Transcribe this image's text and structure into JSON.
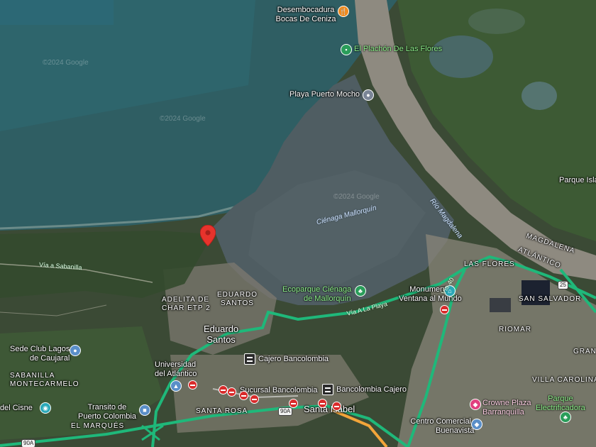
{
  "map": {
    "watermarks": [
      "©2024 Google",
      "©2024 Google",
      "©2024 Google"
    ],
    "water_bodies": {
      "cienaga": "Ciénaga Mallorquín",
      "rio": "Río Magdalena"
    },
    "places": [
      {
        "id": "desembocadura",
        "lines": [
          "Desembocadura",
          "Bocas De Ceniza"
        ],
        "icon": "fork-knife-icon",
        "color": "#ef8b1f"
      },
      {
        "id": "plachon",
        "lines": [
          "El Plachón De Las Flores"
        ],
        "icon": "shop-icon",
        "color": "#2a9d5a"
      },
      {
        "id": "playa",
        "lines": [
          "Playa Puerto Mocho"
        ],
        "icon": "beach-icon",
        "color": "#7a8596"
      },
      {
        "id": "ecoparque",
        "lines": [
          "Ecoparque Ciénaga",
          "de Mallorquín"
        ],
        "icon": "tree-icon",
        "color": "#2a9d5a"
      },
      {
        "id": "monumento",
        "lines": [
          "Monumento",
          "Ventana al Mundo"
        ],
        "icon": "landmark-icon",
        "color": "#2aa8b8"
      },
      {
        "id": "sede_club",
        "lines": [
          "Sede Club Lagos",
          "de Caujaral"
        ],
        "icon": "club-icon",
        "color": "#5a8fc8"
      },
      {
        "id": "universidad",
        "lines": [
          "Universidad",
          "del Atlántico"
        ],
        "icon": "school-icon",
        "color": "#5a8fc8"
      },
      {
        "id": "transito",
        "lines": [
          "Transito de",
          "Puerto Colombia"
        ],
        "icon": "building-icon",
        "color": "#5a8fc8"
      },
      {
        "id": "cajero1",
        "lines": [
          "Cajero Bancolombia"
        ],
        "icon": "bank-icon"
      },
      {
        "id": "sucursal",
        "lines": [
          "Sucursal Bancolombia"
        ],
        "icon": "bank-icon"
      },
      {
        "id": "bancolombia_cajero",
        "lines": [
          "Bancolombia Cajero"
        ],
        "icon": "bank-icon"
      },
      {
        "id": "crowne",
        "lines": [
          "Crowne Plaza",
          "Barranquilla"
        ],
        "icon": "shopping-bag-icon",
        "color": "#e0407f"
      },
      {
        "id": "centro_comercial",
        "lines": [
          "Centro Comercial",
          "Buenavista"
        ],
        "icon": "shopping-bag-icon",
        "color": "#5a8fc8"
      },
      {
        "id": "parque_elec",
        "lines": [
          "Parque",
          "Electrificadora"
        ],
        "icon": "tree-icon",
        "color": "#2a9d5a"
      },
      {
        "id": "del_cisne",
        "lines": [
          "del Cisne"
        ],
        "icon": "camera-icon",
        "color": "#2aa8b8"
      },
      {
        "id": "parque_isla",
        "lines": [
          "Parque Isla"
        ]
      }
    ],
    "areas": {
      "adelita": [
        "ADELITA DE",
        "CHAR ETP 2"
      ],
      "eduardo_santos_small": [
        "EDUARDO",
        "SANTOS"
      ],
      "eduardo_santos_big": [
        "Eduardo",
        "Santos"
      ],
      "sabanilla": [
        "SABANILLA",
        "MONTECARMELO"
      ],
      "las_flores": "LAS FLORES",
      "atlantico": "ATLÁNTICO",
      "magdalena": "MAGDALENA",
      "san_salvador": "SAN SALVADOR",
      "riomar": "RIOMAR",
      "villa_carolina": "VILLA CAROLINA",
      "santa_rosa": "SANTA ROSA",
      "santa_isabel": "Santa Isabel",
      "el_marques": "EL MARQUÉS",
      "gran": "GRAN"
    },
    "roads": {
      "via_sabanilla": "Vía a Sabanilla",
      "via_playa": "Vía A La Playa",
      "via_40": "Vía 40",
      "shield_90a_1": "90A",
      "shield_90a_2": "90A",
      "shield_25": "25"
    },
    "selected_marker": {
      "icon": "red-location-pin-icon",
      "color": "#e8332c"
    },
    "colors": {
      "sea": "#2f5e63",
      "lagoon": "#4f5d62",
      "river": "#8e8a80",
      "traffic": "#1fb87a",
      "traffic_slow": "#f2a53a",
      "land": "#3b4a35"
    }
  }
}
